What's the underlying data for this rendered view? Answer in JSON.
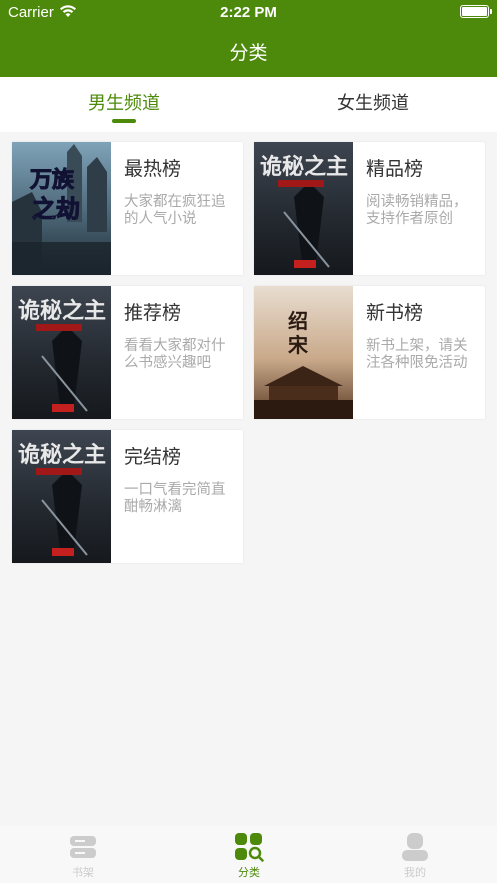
{
  "status_bar": {
    "carrier": "Carrier",
    "time": "2:22 PM"
  },
  "nav": {
    "title": "分类"
  },
  "tabs": {
    "male": "男生频道",
    "female": "女生频道"
  },
  "cards": [
    {
      "title": "最热榜",
      "desc": "大家都在疯狂追的人气小说",
      "cover_text": "万族之劫"
    },
    {
      "title": "精品榜",
      "desc": "阅读畅销精品，支持作者原创",
      "cover_text": "诡秘之主"
    },
    {
      "title": "推荐榜",
      "desc": "看看大家都对什么书感兴趣吧",
      "cover_text": "诡秘之主"
    },
    {
      "title": "新书榜",
      "desc": "新书上架，请关注各种限免活动",
      "cover_text": "绍宋"
    },
    {
      "title": "完结榜",
      "desc": "一口气看完简直酣畅淋漓",
      "cover_text": "诡秘之主"
    }
  ],
  "tabbar": {
    "bookshelf": "书架",
    "category": "分类",
    "mine": "我的"
  },
  "colors": {
    "brand": "#4d8a0b",
    "inactive": "#cccccc"
  }
}
